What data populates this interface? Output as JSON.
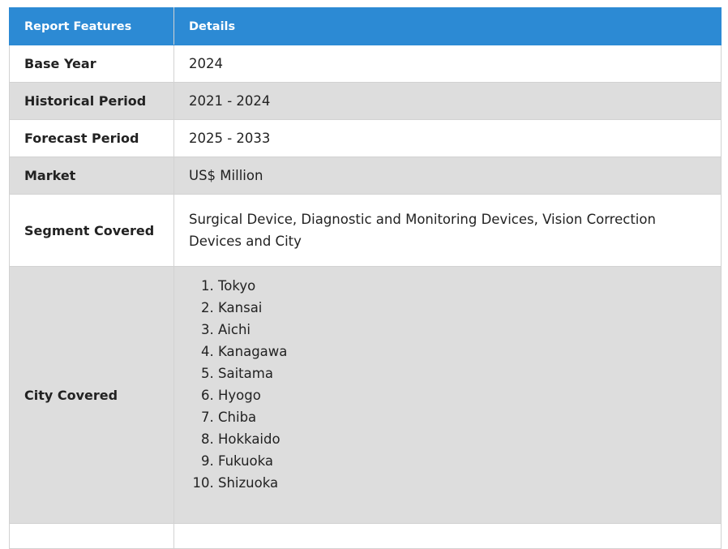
{
  "table": {
    "headers": [
      "Report Features",
      "Details"
    ],
    "rows": [
      {
        "feature": "Base Year",
        "detail": "2024"
      },
      {
        "feature": "Historical Period",
        "detail": "2021 - 2024"
      },
      {
        "feature": "Forecast Period",
        "detail": "2025 - 2033"
      },
      {
        "feature": "Market",
        "detail": "US$ Million"
      },
      {
        "feature": "Segment Covered",
        "detail": "Surgical Device, Diagnostic and Monitoring Devices, Vision Correction Devices and City"
      },
      {
        "feature": "City Covered",
        "detail": ""
      }
    ],
    "cities": [
      "Tokyo",
      "Kansai",
      "Aichi",
      "Kanagawa",
      "Saitama",
      "Hyogo",
      "Chiba",
      "Hokkaido",
      "Fukuoka",
      "Shizuoka"
    ]
  }
}
